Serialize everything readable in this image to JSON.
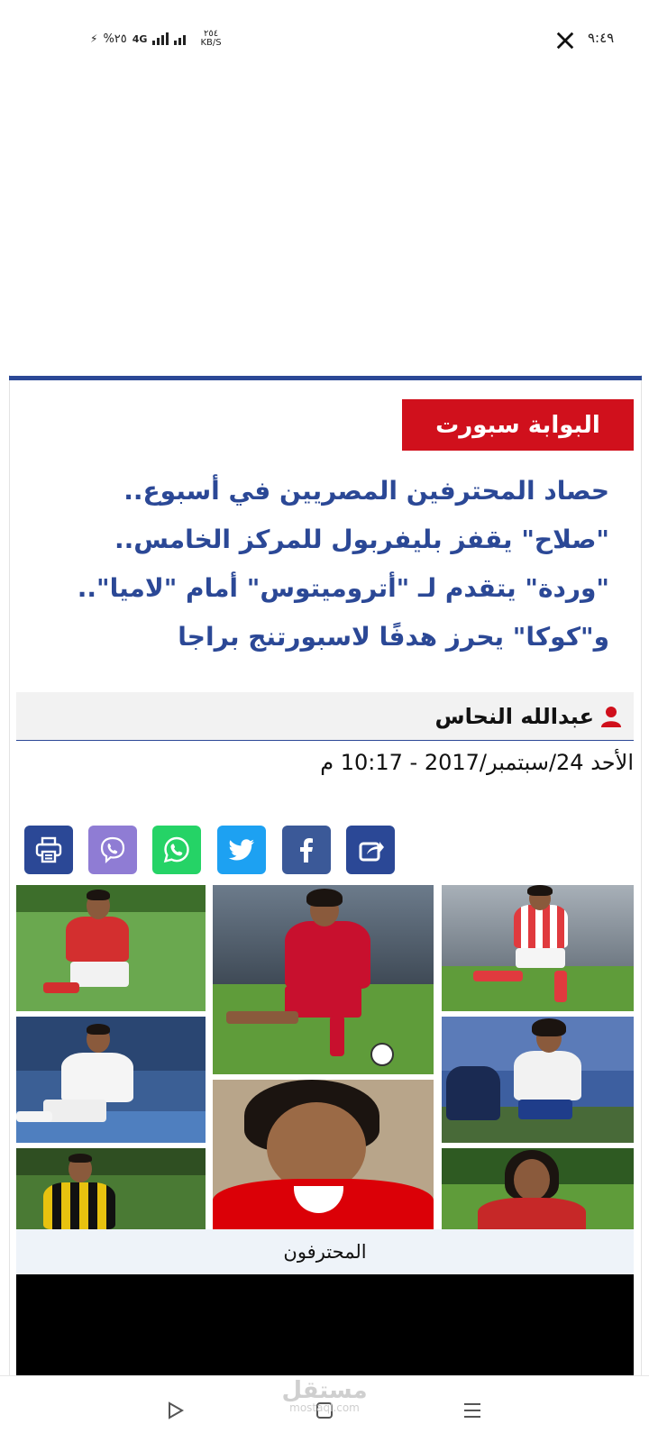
{
  "status_bar": {
    "time": "٩:٤٩",
    "speed_value": "٢٥٤",
    "speed_unit": "KB/S",
    "network": "4G",
    "battery": "%٢٥"
  },
  "article": {
    "section_badge": "البوابة سبورت",
    "headline": "حصاد المحترفين المصريين في أسبوع.. \"صلاح\" يقفز بليفربول للمركز الخامس.. \"وردة\" يتقدم لـ \"أتروميتوس\" أمام \"لاميا\".. و\"كوكا\" يحرز هدفًا لاسبورتنج براجا",
    "author": "عبدالله النحاس",
    "date": "الأحد 24/سبتمبر/2017 - 10:17 م",
    "image_caption": "المحترفون"
  },
  "share_buttons": [
    {
      "name": "share",
      "color": "#2b4896"
    },
    {
      "name": "facebook",
      "color": "#3b5998"
    },
    {
      "name": "twitter",
      "color": "#1da1f2"
    },
    {
      "name": "whatsapp",
      "color": "#25d366"
    },
    {
      "name": "viber",
      "color": "#8f7cd4"
    },
    {
      "name": "print",
      "color": "#2b4896"
    }
  ],
  "watermark": {
    "text": "مستقل",
    "sub": "mostaql.com"
  },
  "colors": {
    "accent_blue": "#2b4896",
    "badge_red": "#d0101c"
  }
}
